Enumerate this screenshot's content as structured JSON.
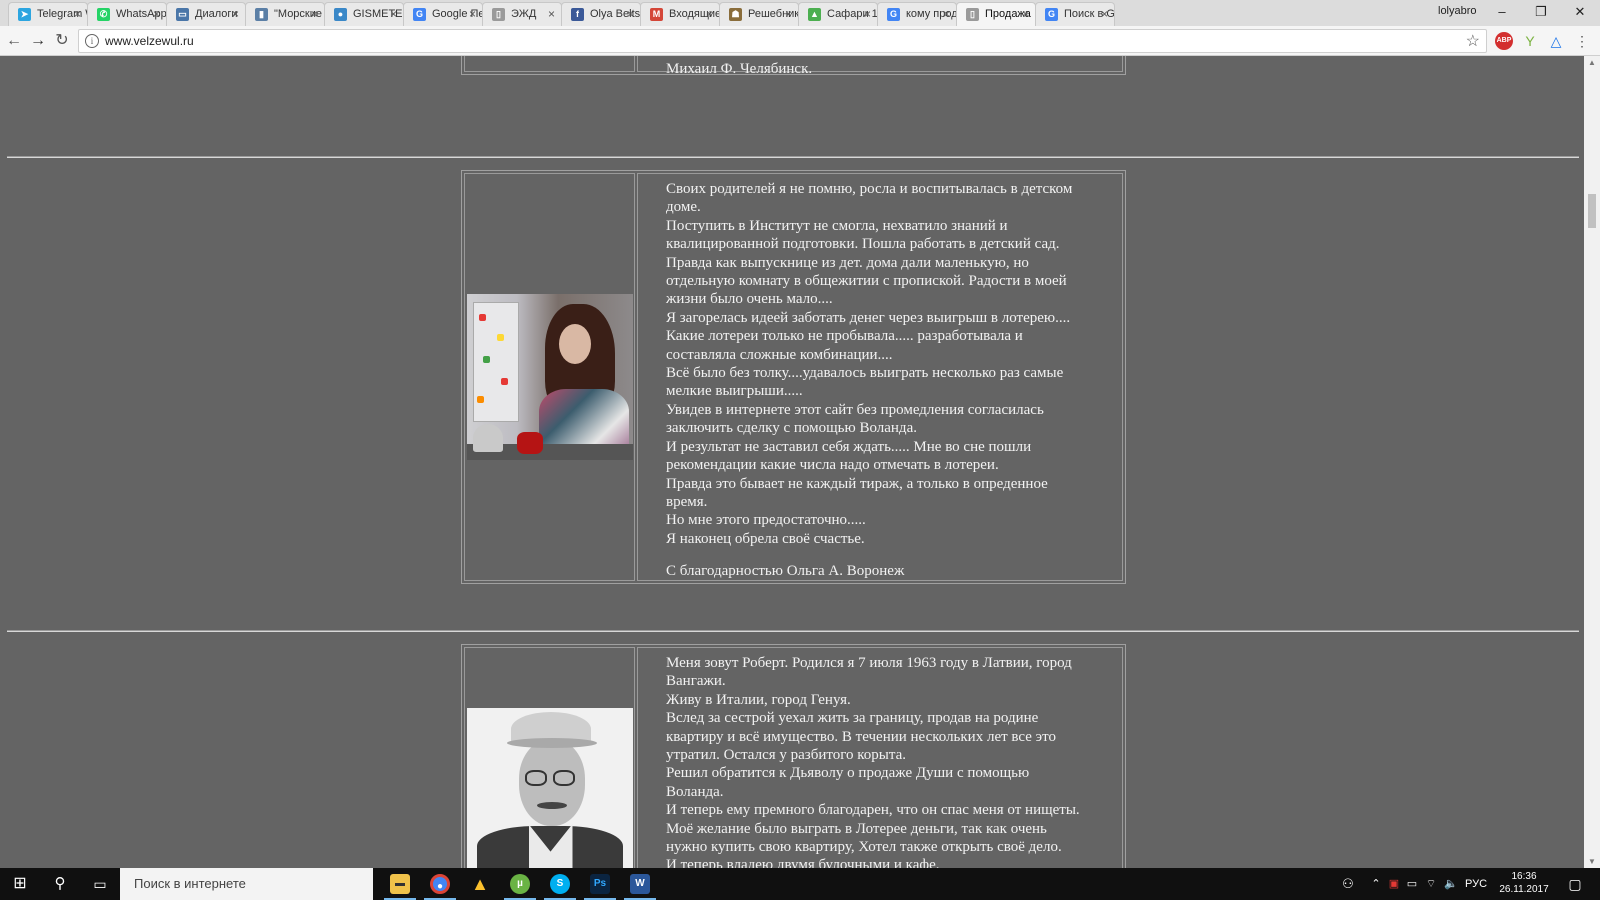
{
  "browser": {
    "tabs": [
      {
        "label": "Telegram W",
        "icon_color": "#2ca5e0",
        "icon_char": "➤"
      },
      {
        "label": "WhatsApp",
        "icon_color": "#25d366",
        "icon_char": "✆"
      },
      {
        "label": "Диалоги",
        "icon_color": "#4a76a8",
        "icon_char": "▭"
      },
      {
        "label": "\"Морские",
        "icon_color": "#5b7fa6",
        "icon_char": "▮"
      },
      {
        "label": "GISMETEO",
        "icon_color": "#3a88c8",
        "icon_char": "●"
      },
      {
        "label": "Google Пе",
        "icon_color": "#4285f4",
        "icon_char": "G"
      },
      {
        "label": "ЭЖД",
        "icon_color": "#9a9a9a",
        "icon_char": "▯"
      },
      {
        "label": "Olya Belts",
        "icon_color": "#3b5998",
        "icon_char": "f"
      },
      {
        "label": "Входящие",
        "icon_color": "#d44638",
        "icon_char": "M"
      },
      {
        "label": "Решебник",
        "icon_color": "#8a6d3b",
        "icon_char": "☗"
      },
      {
        "label": "Сафари 1",
        "icon_color": "#4caf50",
        "icon_char": "▲"
      },
      {
        "label": "кому прод",
        "icon_color": "#4285f4",
        "icon_char": "G"
      },
      {
        "label": "Продажа",
        "icon_color": "#9a9a9a",
        "icon_char": "▯",
        "active": true
      },
      {
        "label": "Поиск в G",
        "icon_color": "#4285f4",
        "icon_char": "G"
      }
    ],
    "tab_close_glyph": "×",
    "profile_name": "lolyabro",
    "window_controls": {
      "minimize": "–",
      "maximize": "❐",
      "close": "✕"
    },
    "url": "www.velzewul.ru",
    "ext_abp": "ABP"
  },
  "page": {
    "top_signature": "Михаил Ф.   Челябинск.",
    "testimonials": [
      {
        "lines": [
          "Своих родителей я не помню, росла и воспитывалась в детском",
          "доме.",
          "Поступить в Институт не смогла, нехватило знаний и",
          "квалицированной подготовки. Пошла работать в детский сад.",
          "Правда как выпускнице из дет. дома дали маленькую, но",
          "отдельную комнату в общежитии с пропиской. Радости в моей",
          "жизни было очень мало....",
          "Я загорелась идеей заботать денег через выигрыш в лотерею....",
          "Какие лотереи только не пробывала..... разработывала и",
          "составляла сложные комбинации....",
          "Всё было без толку....удавалось выиграть несколько раз самые",
          "мелкие выигрыши.....",
          "Увидев в интернете этот сайт без промедления согласилась",
          "заключить сделку с помощью Воланда.",
          "И результат не заставил себя ждать..... Мне во сне пошли",
          "рекомендации какие числа надо отмечать в лотереи.",
          "Правда это бывает не каждый тираж, а только в опреденное",
          "время.",
          "Но мне этого предостаточно.....",
          "Я наконец обрела своё счастье."
        ],
        "signature": "С благодарностью Ольга   А. Воронеж"
      },
      {
        "lines": [
          "Меня зовут Роберт. Родился я 7 июля 1963 году в Латвии, город",
          "Вангажи.",
          "Живу в Италии, город Генуя.",
          "Вслед за сестрой уехал жить за границу, продав на родине",
          "квартиру и всё имущество. В течении нескольких лет все это",
          "утратил. Остался у разбитого корыта.",
          "Решил обратится к Дьяволу о продаже Души с помощью",
          "Воланда.",
          "И теперь ему премного благодарен, что он спас меня от нищеты.",
          "Моё желание было выграть в Лотерее деньги, так как очень",
          "нужно купить свою квартиру, Хотел также открыть своё дело.",
          "И теперь владею двумя булочными и кафе."
        ]
      }
    ]
  },
  "taskbar": {
    "search_placeholder": "Поиск в интернете",
    "language": "РУС",
    "time": "16:36",
    "date": "26.11.2017"
  }
}
